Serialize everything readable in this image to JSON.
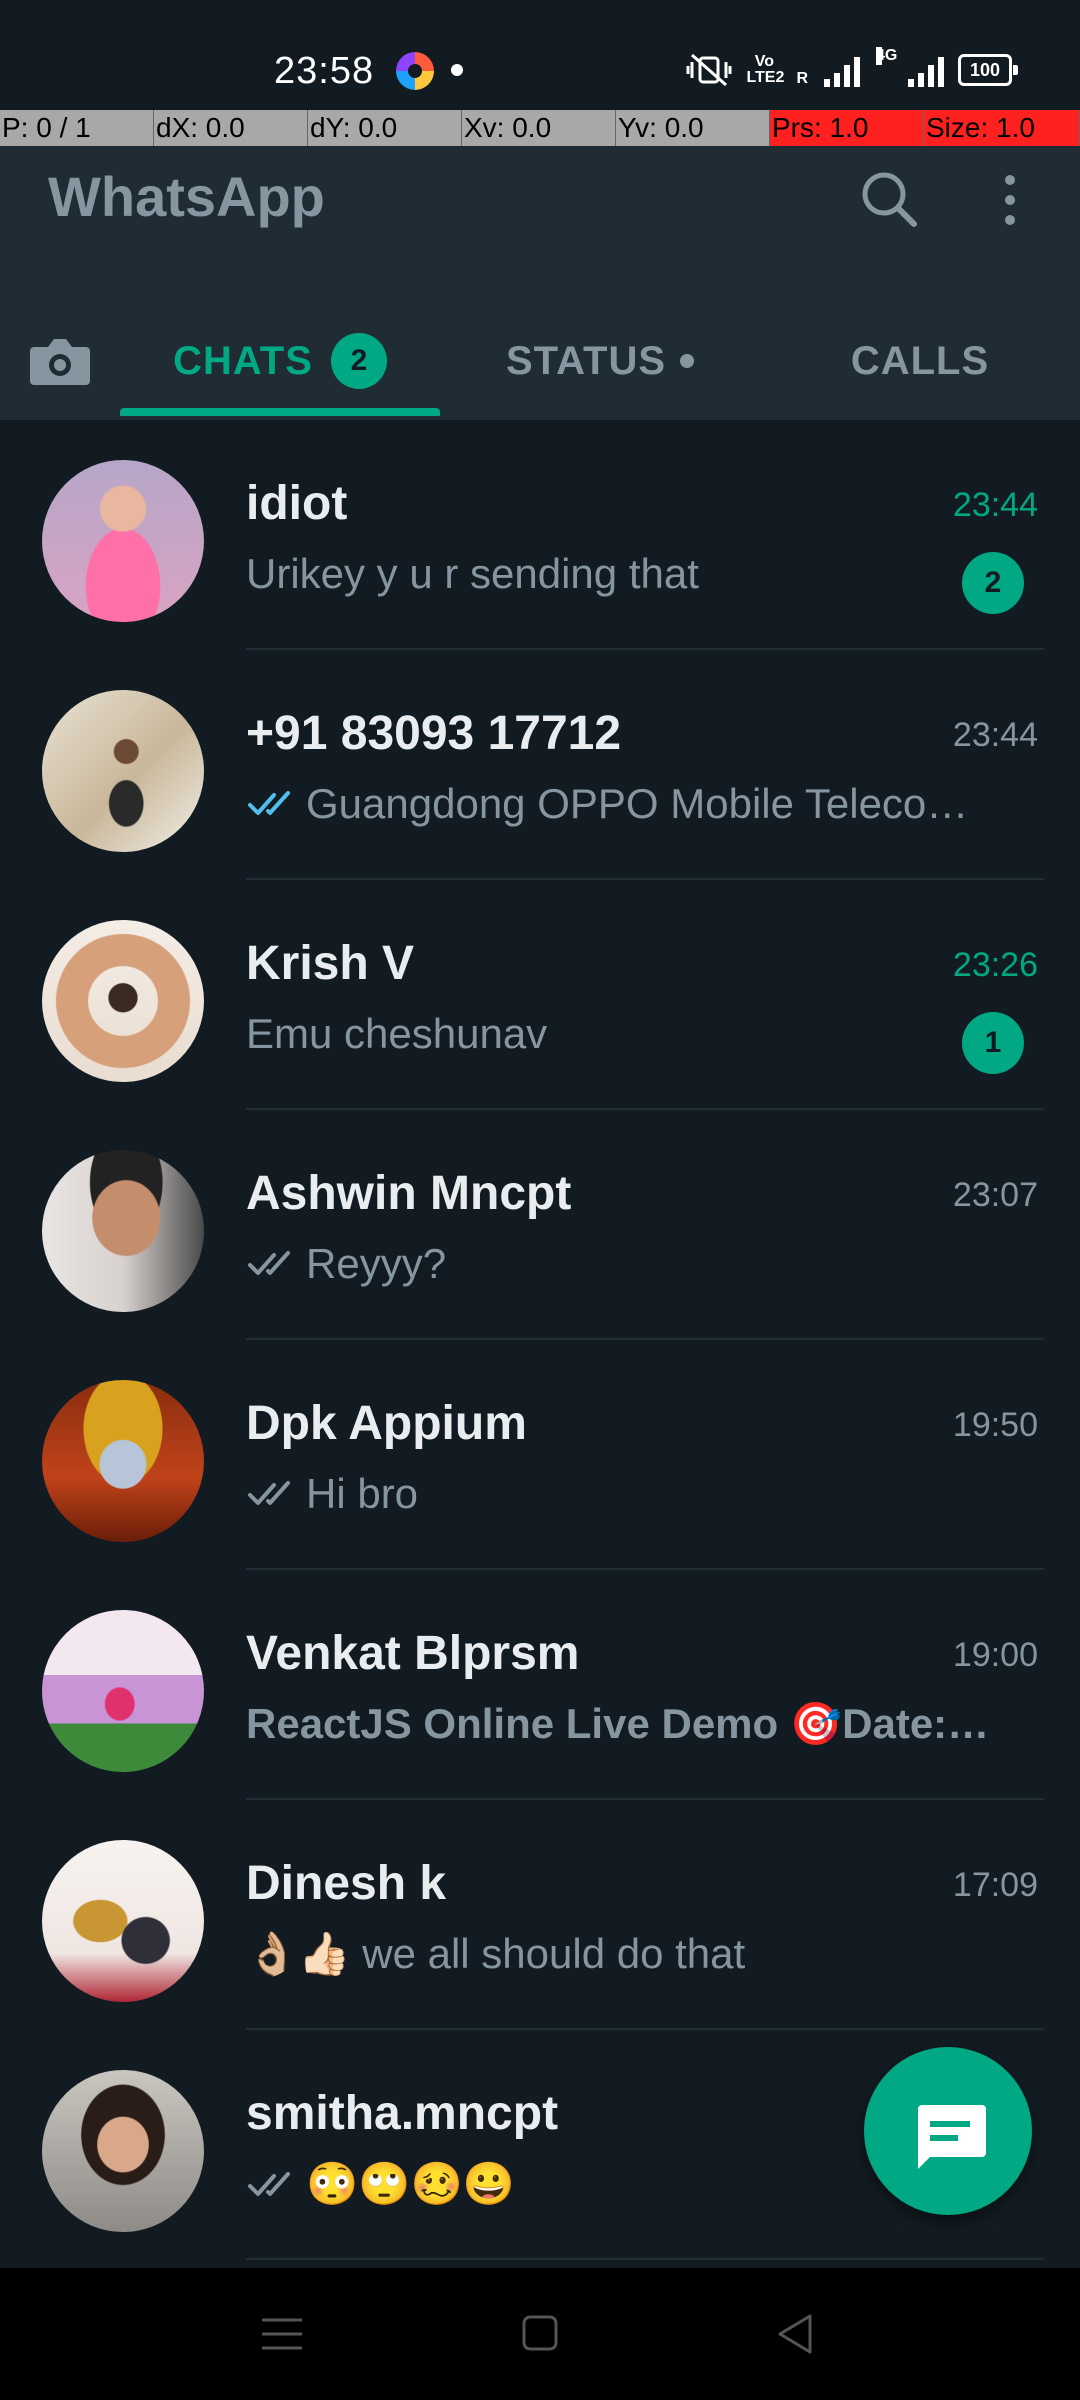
{
  "status_bar": {
    "time": "23:58",
    "network_lte": "LTE2",
    "network_r": "R",
    "network_4g": "4G",
    "battery": "100"
  },
  "debug_overlay": {
    "pointer": "P: 0 / 1",
    "dx": "dX: 0.0",
    "dy": "dY: 0.0",
    "xv": "Xv: 0.0",
    "yv": "Yv: 0.0",
    "prs": "Prs: 1.0",
    "size": "Size: 1.0"
  },
  "header": {
    "title": "WhatsApp",
    "icons": [
      "search-icon",
      "more-vert-icon"
    ]
  },
  "tabs": {
    "camera_icon": "camera-icon",
    "chats_label": "CHATS",
    "chats_badge": "2",
    "status_label": "STATUS",
    "calls_label": "CALLS",
    "active": "CHATS"
  },
  "chats": [
    {
      "name": "idiot",
      "message": "Urikey y u r sending that",
      "time": "23:44",
      "unread": "2",
      "ticks": "none"
    },
    {
      "name": "+91 83093 17712",
      "message": "Guangdong OPPO Mobile Teleco…",
      "time": "23:44",
      "unread": "",
      "ticks": "read"
    },
    {
      "name": "Krish V",
      "message": "Emu cheshunav",
      "time": "23:26",
      "unread": "1",
      "ticks": "none"
    },
    {
      "name": "Ashwin Mncpt",
      "message": "Reyyy?",
      "time": "23:07",
      "unread": "",
      "ticks": "delivered"
    },
    {
      "name": "Dpk Appium",
      "message": "Hi bro",
      "time": "19:50",
      "unread": "",
      "ticks": "delivered"
    },
    {
      "name": "Venkat Blprsm",
      "message": "ReactJS  Online Live Demo 🎯Date:…",
      "time": "19:00",
      "unread": "",
      "ticks": "none"
    },
    {
      "name": "Dinesh k",
      "message": "👌🏼👍🏻 we all should do that",
      "time": "17:09",
      "unread": "",
      "ticks": "none"
    },
    {
      "name": "smitha.mncpt",
      "message": "😳🙄🥴😀",
      "time": "",
      "unread": "",
      "ticks": "delivered"
    }
  ],
  "fab": {
    "icon": "new-chat-icon"
  },
  "colors": {
    "accent": "#00a884",
    "background": "#111b21",
    "header": "#1f2c34",
    "secondary_text": "#8696a0",
    "read_ticks": "#53bdeb"
  }
}
